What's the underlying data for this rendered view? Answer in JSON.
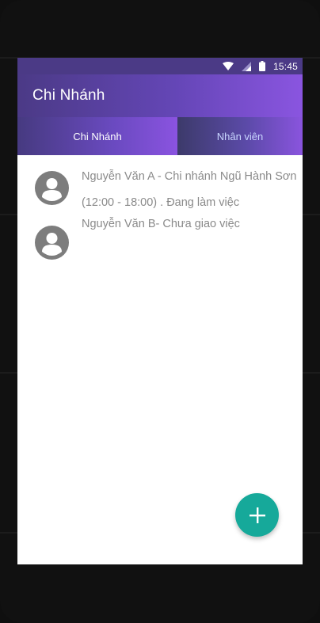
{
  "status_bar": {
    "time": "15:45",
    "icons": [
      "wifi-icon",
      "cell-signal-icon",
      "battery-icon"
    ]
  },
  "appbar": {
    "title": "Chi Nhánh"
  },
  "tabs": [
    {
      "label": "Chi Nhánh",
      "active": true
    },
    {
      "label": "Nhân viên",
      "active": false
    }
  ],
  "list": {
    "items": [
      {
        "line1": "Nguyễn Văn A - Chi nhánh Ngũ Hành Sơn",
        "line2": "(12:00 - 18:00) . Đang làm việc",
        "icon": "account-circle-icon"
      },
      {
        "line1": "Nguyễn Văn B- Chưa giao việc",
        "icon": "account-circle-icon"
      }
    ]
  },
  "fab": {
    "icon": "plus-icon",
    "color": "#16a99a"
  },
  "colors": {
    "primary_dark": "#4b3a86",
    "primary_light": "#8a55e0",
    "accent": "#16a99a",
    "text_secondary": "#8a8a8a"
  }
}
